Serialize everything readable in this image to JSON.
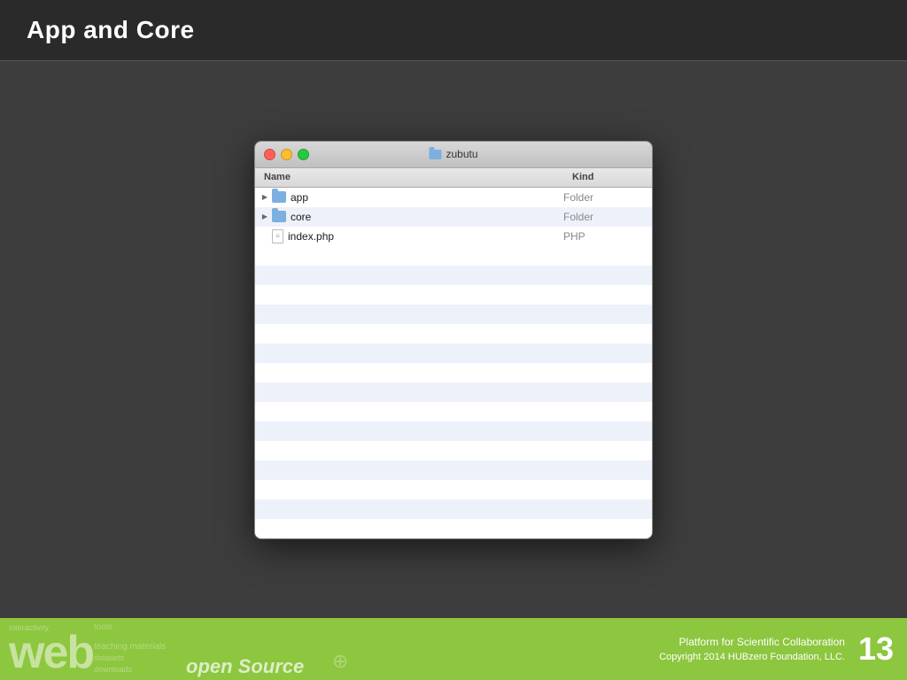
{
  "header": {
    "title": "App and Core"
  },
  "finder": {
    "window_title": "zubutu",
    "columns": {
      "name": "Name",
      "kind": "Kind"
    },
    "files": [
      {
        "name": "app",
        "kind": "Folder",
        "type": "folder",
        "expandable": true
      },
      {
        "name": "core",
        "kind": "Folder",
        "type": "folder",
        "expandable": true
      },
      {
        "name": "index.php",
        "kind": "PHP",
        "type": "file",
        "expandable": false
      }
    ]
  },
  "footer": {
    "word_cloud_items": [
      "interactivity",
      "web",
      "tools",
      "teaching materials",
      "datasets",
      "downloads",
      "open source"
    ],
    "open_source_label": "open Source",
    "platform_text": "Platform for Scientific Collaboration",
    "copyright_text": "Copyright  2014 HUBzero Foundation, LLC.",
    "page_number": "13"
  }
}
